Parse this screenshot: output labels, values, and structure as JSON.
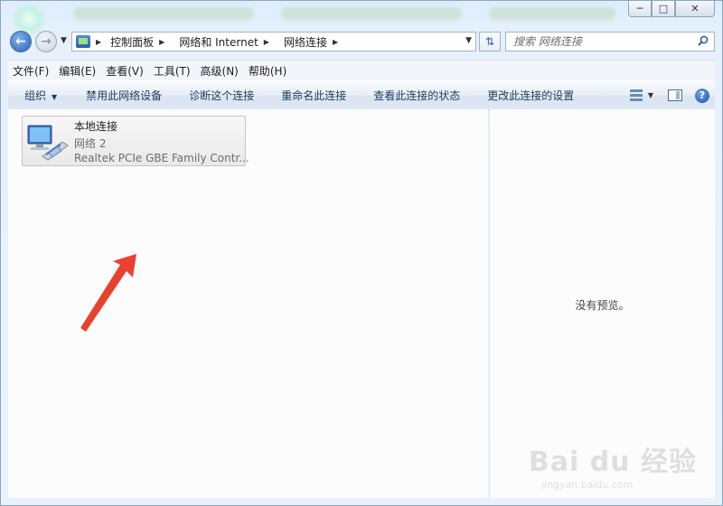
{
  "window": {
    "buttons": {
      "minimize": "─",
      "maximize": "□",
      "close": "✕"
    }
  },
  "nav": {
    "back_icon": "back-arrow-icon",
    "forward_icon": "forward-arrow-icon"
  },
  "address": {
    "crumbs": [
      "控制面板",
      "网络和 Internet",
      "网络连接"
    ]
  },
  "search": {
    "placeholder": "搜索 网络连接"
  },
  "menubar": {
    "items": [
      "文件(F)",
      "编辑(E)",
      "查看(V)",
      "工具(T)",
      "高级(N)",
      "帮助(H)"
    ]
  },
  "toolbar": {
    "organize": "组织",
    "commands": [
      "禁用此网络设备",
      "诊断这个连接",
      "重命名此连接",
      "查看此连接的状态",
      "更改此连接的设置"
    ]
  },
  "connection": {
    "name": "本地连接",
    "status": "网络  2",
    "device": "Realtek PCIe GBE Family Contr..."
  },
  "preview": {
    "message": "没有预览。"
  },
  "watermark": {
    "logo": "Bai du 经验",
    "url": "jingyan.baidu.com"
  },
  "colors": {
    "accent": "#2a5fb3",
    "arrow": "#e8412e",
    "background": "#fcfcfc"
  }
}
